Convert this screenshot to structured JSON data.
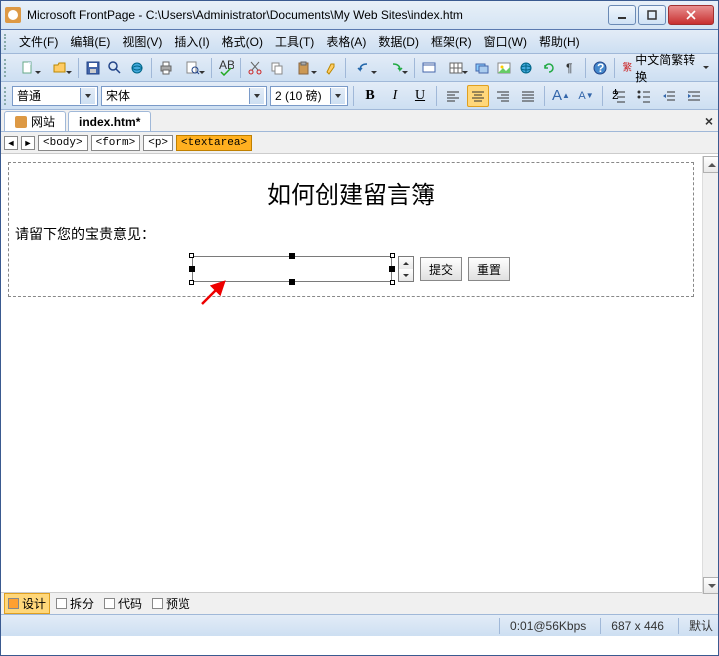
{
  "window": {
    "title": "Microsoft FrontPage - C:\\Users\\Administrator\\Documents\\My Web Sites\\index.htm"
  },
  "menu": {
    "file": "文件(F)",
    "edit": "编辑(E)",
    "view": "视图(V)",
    "insert": "插入(I)",
    "format": "格式(O)",
    "tools": "工具(T)",
    "table": "表格(A)",
    "data": "数据(D)",
    "frames": "框架(R)",
    "window": "窗口(W)",
    "help": "帮助(H)"
  },
  "toolbar2": {
    "convert": "中文简繁转换"
  },
  "format": {
    "style": "普通",
    "font": "宋体",
    "size": "2 (10 磅)",
    "bold": "B",
    "italic": "I",
    "underline": "U",
    "fontA": "A"
  },
  "tabs": {
    "site": "网站",
    "file": "index.htm*"
  },
  "breadcrumb": {
    "body": "<body>",
    "form": "<form>",
    "p": "<p>",
    "textarea": "<textarea>"
  },
  "page": {
    "heading": "如何创建留言簿",
    "label": "请留下您的宝贵意见：",
    "submit": "提交",
    "reset": "重置"
  },
  "viewtabs": {
    "design": "设计",
    "split": "拆分",
    "code": "代码",
    "preview": "预览"
  },
  "status": {
    "speed": "0:01@56Kbps",
    "dims": "687 x 446",
    "mode": "默认"
  }
}
